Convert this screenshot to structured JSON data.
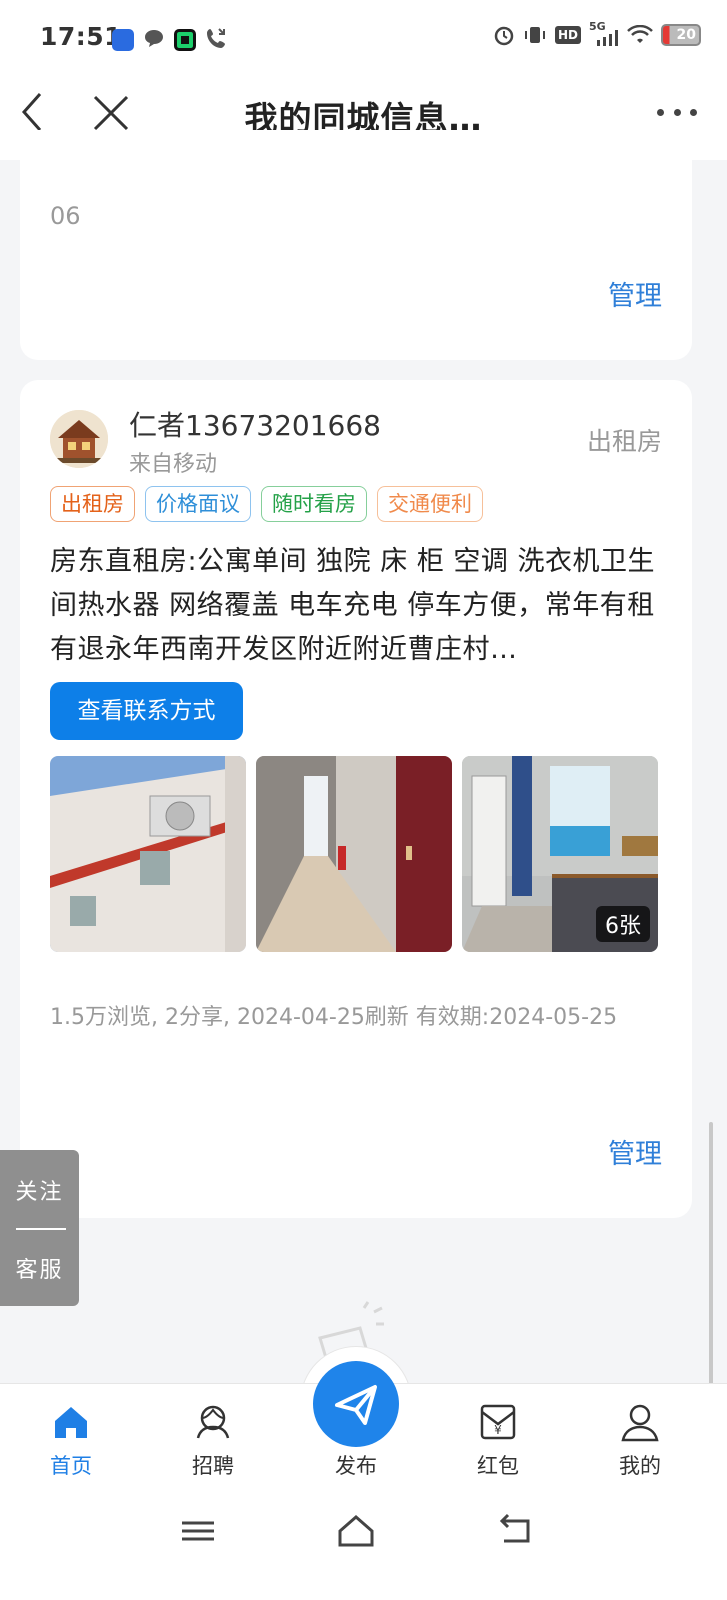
{
  "status_bar": {
    "time": "17:51",
    "battery": "20",
    "network": "5G",
    "hd": "HD",
    "icons": [
      "app-shield-icon",
      "message-bubble-icon",
      "app-green-icon",
      "phone-missed-icon",
      "alarm-icon",
      "vibrate-icon",
      "hd-icon",
      "signal-icon",
      "wifi-icon",
      "battery-icon"
    ]
  },
  "header": {
    "title": "我的同城信息…",
    "back_icon": "chevron-left-icon",
    "close_icon": "close-icon",
    "more_icon": "more-dots-icon"
  },
  "prev_card": {
    "tail_text": "06",
    "manage_label": "管理"
  },
  "listing": {
    "username": "仁者13673201668",
    "source": "来自移动",
    "category": "出租房",
    "tags": [
      "出租房",
      "价格面议",
      "随时看房",
      "交通便利"
    ],
    "description": "房东直租房:公寓单间 独院 床 柜 空调 洗衣机卫生间热水器 网络覆盖 电车充电 停车方便，常年有租有退永年西南开发区附近附近曹庄村…",
    "contact_button": "查看联系方式",
    "photo_count": "6张",
    "meta": "1.5万浏览, 2分享, 2024-04-25刷新 有效期:2024-05-25",
    "manage_label": "管理"
  },
  "floater": {
    "follow": "关注",
    "service": "客服"
  },
  "bottom_nav": {
    "items": [
      {
        "label": "首页",
        "icon": "home-icon",
        "active": true
      },
      {
        "label": "招聘",
        "icon": "recruit-icon",
        "active": false
      },
      {
        "label": "发布",
        "icon": "send-icon",
        "active": false
      },
      {
        "label": "红包",
        "icon": "red-envelope-icon",
        "active": false
      },
      {
        "label": "我的",
        "icon": "user-icon",
        "active": false
      }
    ]
  },
  "colors": {
    "accent": "#1f84ea",
    "manage": "#2f7fd8",
    "tag_orange": "#e4621a",
    "tag_blue": "#2f8fd8",
    "tag_green": "#24a148"
  }
}
